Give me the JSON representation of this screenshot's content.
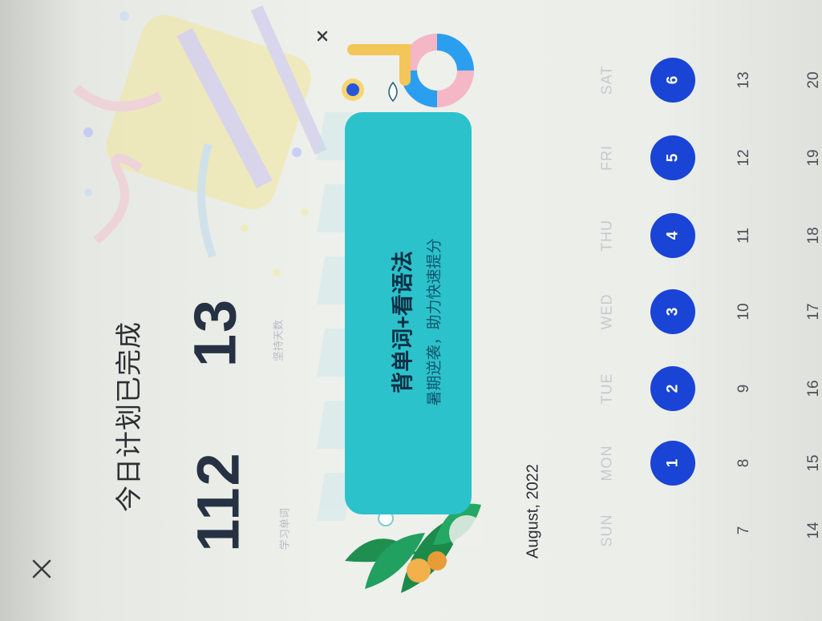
{
  "header": {
    "close_icon": "close-icon",
    "title": "今日计划已完成"
  },
  "stats": [
    {
      "value": "112",
      "label": "学习单词"
    },
    {
      "value": "13",
      "label": "坚持天数"
    }
  ],
  "banner": {
    "title": "背单词+看语法",
    "subtitle": "暑期逆袭，助力快速提分",
    "close_icon": "close-icon",
    "accent_color": "#2bc2cc"
  },
  "calendar": {
    "month_label": "August, 2022",
    "weekdays": [
      "SUN",
      "MON",
      "TUE",
      "WED",
      "THU",
      "FRI",
      "SAT"
    ],
    "selected_color": "#1a44d6",
    "weeks": [
      [
        "",
        "1",
        "2",
        "3",
        "4",
        "5",
        "6"
      ],
      [
        "7",
        "8",
        "9",
        "10",
        "11",
        "12",
        "13"
      ],
      [
        "14",
        "15",
        "16",
        "17",
        "18",
        "19",
        "20"
      ]
    ],
    "completed_days": [
      "1",
      "2",
      "3",
      "4",
      "5",
      "6"
    ]
  }
}
